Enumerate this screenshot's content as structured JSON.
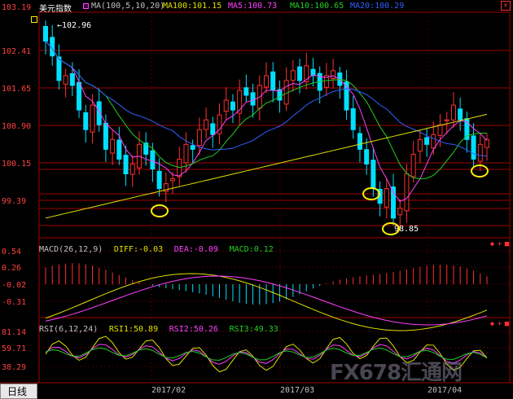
{
  "header": {
    "symbol": "美元指数",
    "ma_label": "MA(100,5,10,20)",
    "ma100": "MA100:101.15",
    "ma5": "MA5:100.73",
    "ma10": "MA10:100.65",
    "ma20": "MA20:100.29",
    "corner_value": "103.19"
  },
  "price_axis": [
    "102.41",
    "101.65",
    "100.90",
    "100.15",
    "99.39"
  ],
  "annotations": {
    "high": "102.96",
    "low": "98.85"
  },
  "macd": {
    "label": "MACD(26,12,9)",
    "diff": "DIFF:-0.03",
    "dea": "DEA:-0.09",
    "macd": "MACD:0.12",
    "axis": [
      "0.54",
      "0.26",
      "-0.02",
      "-0.31"
    ]
  },
  "rsi": {
    "label": "RSI(6,12,24)",
    "rsi1": "RSI1:50.89",
    "rsi2": "RSI2:50.26",
    "rsi3": "RSI3:49.33",
    "axis": [
      "81.14",
      "59.71",
      "38.29"
    ]
  },
  "footer": {
    "tab_day": "日线",
    "dates": [
      "2017/02",
      "2017/03",
      "2017/04"
    ],
    "watermark": "FX678汇通网"
  },
  "colors": {
    "up": "#ff3030",
    "down": "#00e0ff",
    "ma5": "#ff40ff",
    "ma10": "#20d020",
    "ma20": "#3060ff",
    "ma100": "#e0e000",
    "grid": "#a00000",
    "highlight": "#ffee00"
  }
}
